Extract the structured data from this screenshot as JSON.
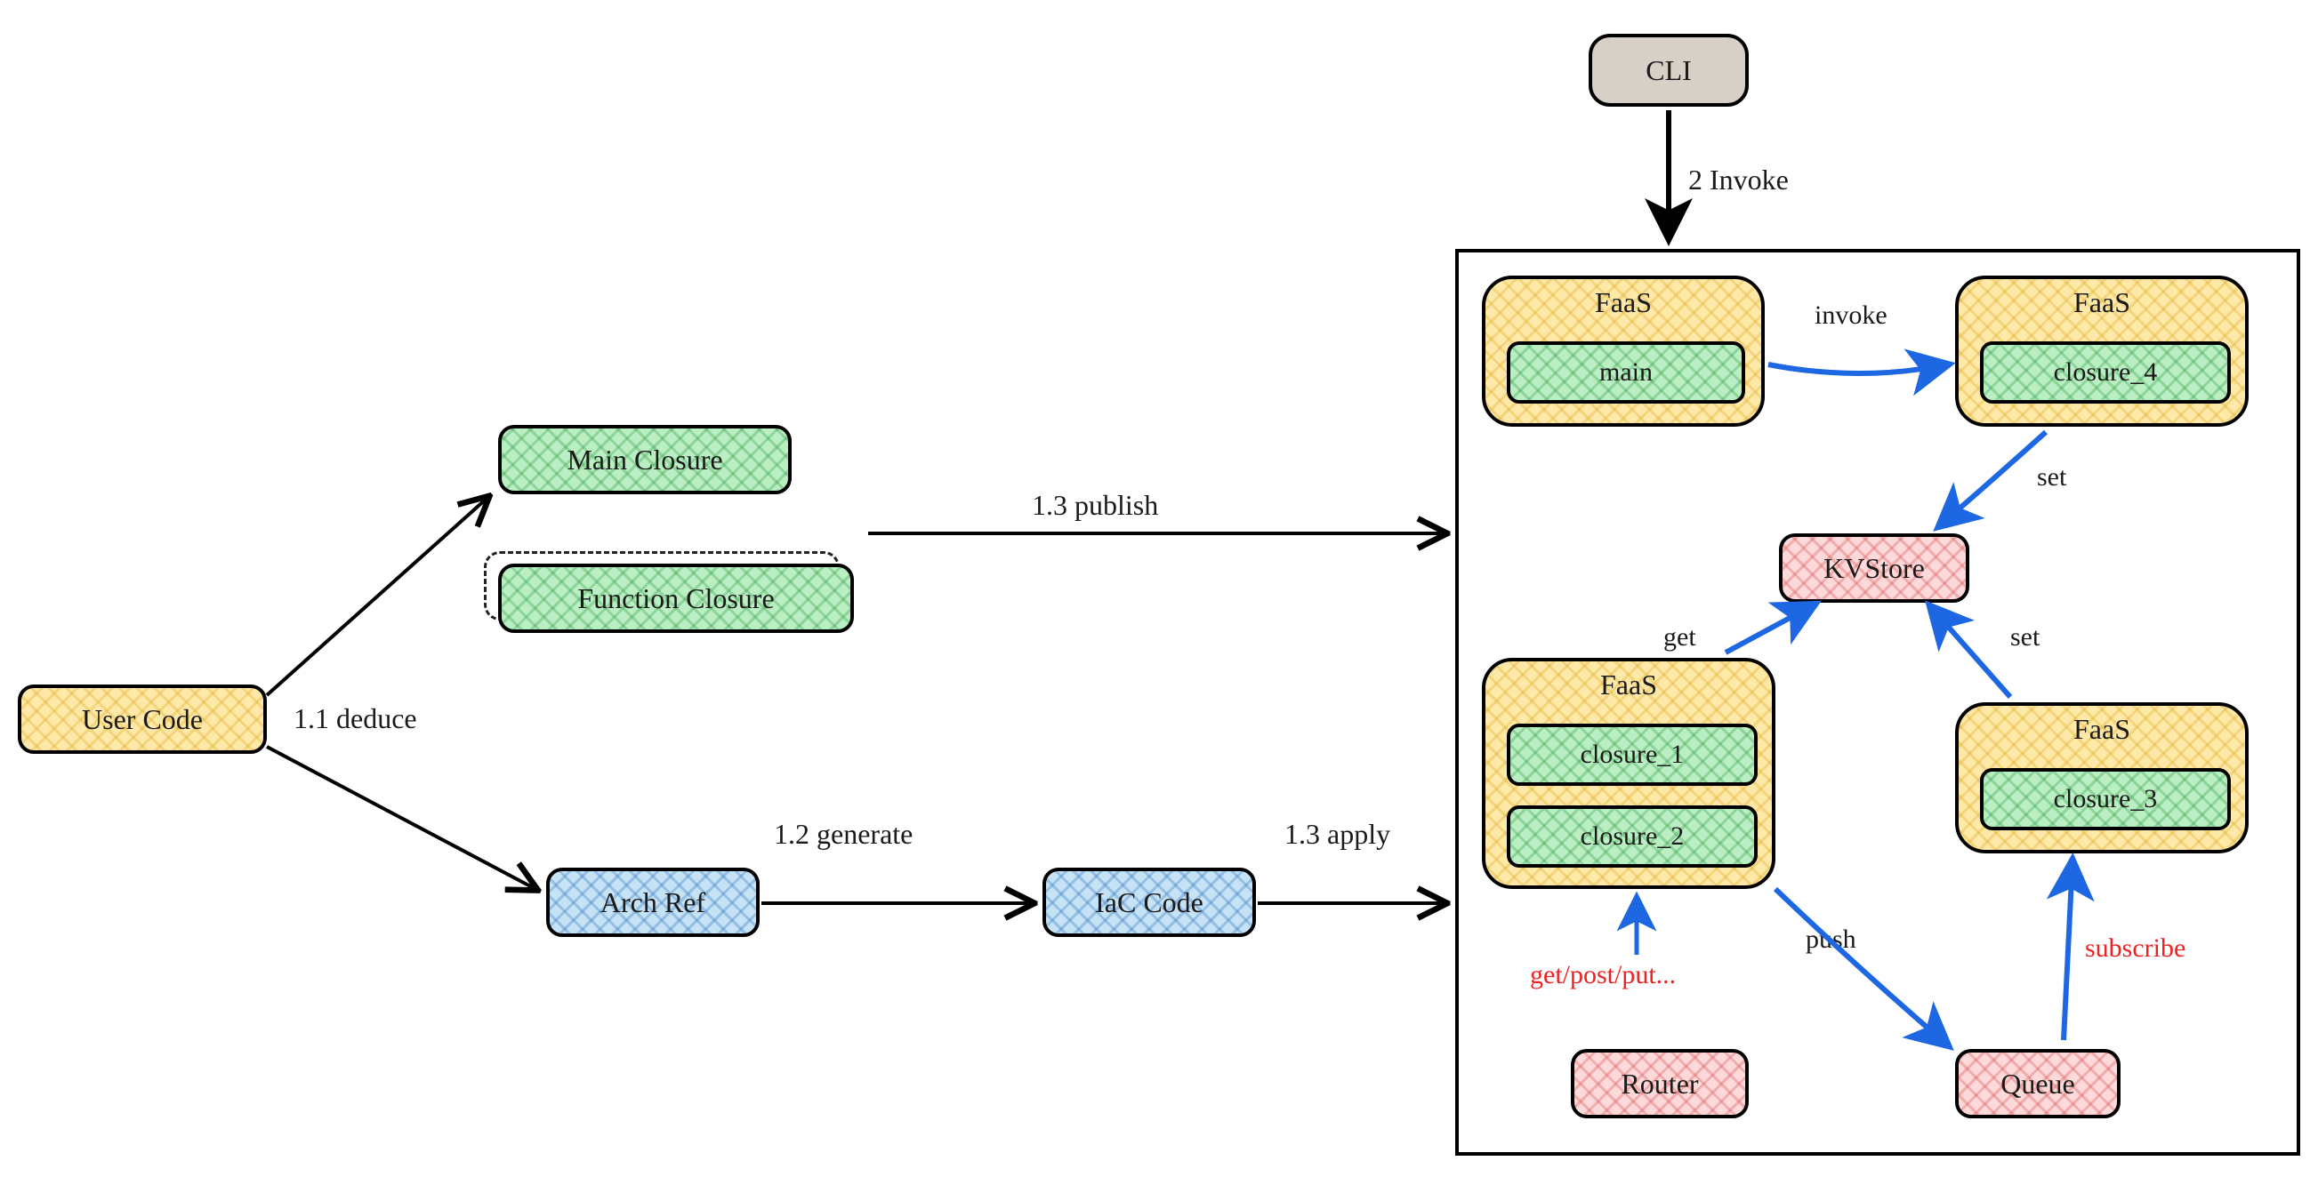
{
  "nodes": {
    "user_code": "User Code",
    "main_closure": "Main Closure",
    "function_closure": "Function Closure",
    "arch_ref": "Arch Ref",
    "iac_code": "IaC Code",
    "cli": "CLI"
  },
  "faas": {
    "main": {
      "title": "FaaS",
      "fn": "main"
    },
    "c4": {
      "title": "FaaS",
      "fn": "closure_4"
    },
    "c12": {
      "title": "FaaS",
      "fn1": "closure_1",
      "fn2": "closure_2"
    },
    "c3": {
      "title": "FaaS",
      "fn": "closure_3"
    }
  },
  "cloud": {
    "kvstore": "KVStore",
    "router": "Router",
    "queue": "Queue"
  },
  "edges": {
    "deduce": "1.1 deduce",
    "generate": "1.2 generate",
    "publish": "1.3 publish",
    "apply": "1.3 apply",
    "invoke2": "2 Invoke",
    "invoke": "invoke",
    "set1": "set",
    "set2": "set",
    "get": "get",
    "push": "push",
    "subscribe": "subscribe",
    "http": "get/post/put..."
  }
}
